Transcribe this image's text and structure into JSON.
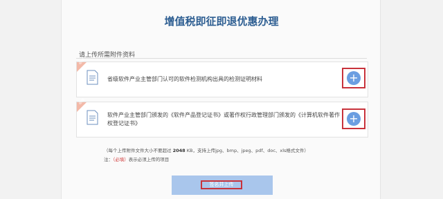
{
  "page": {
    "title": "增值税即征即退优惠办理",
    "subtitle": "请上传所需附件资料"
  },
  "attachments": [
    {
      "badge": "必填",
      "text": "省级软件产业主管部门认可的软件检测机构出具的检测证明材料",
      "icon": "document-icon",
      "add_icon": "plus-circle-icon"
    },
    {
      "badge": "必填",
      "text": "软件产业主管部门颁发的《软件产品登记证书》或著作权行政管理部门颁发的《计算机软件著作权登记证书》",
      "icon": "document-icon",
      "add_icon": "plus-circle-icon"
    }
  ],
  "notes": {
    "size_prefix": "（每个上传附件文件大小不要超过",
    "size_value": "2048",
    "size_suffix": "KB，支持上传jpg、bmp、jpeg、pdf、doc、xls格式文件）",
    "required_prefix": "注：",
    "required_tag": "（必填）",
    "required_suffix": "表示必须上传的项目"
  },
  "submit_label": "签名并上传",
  "colors": {
    "title": "#2c5d91",
    "accent": "#6b9ee1",
    "highlight": "#c8323b",
    "button": "#a9c6ec"
  }
}
